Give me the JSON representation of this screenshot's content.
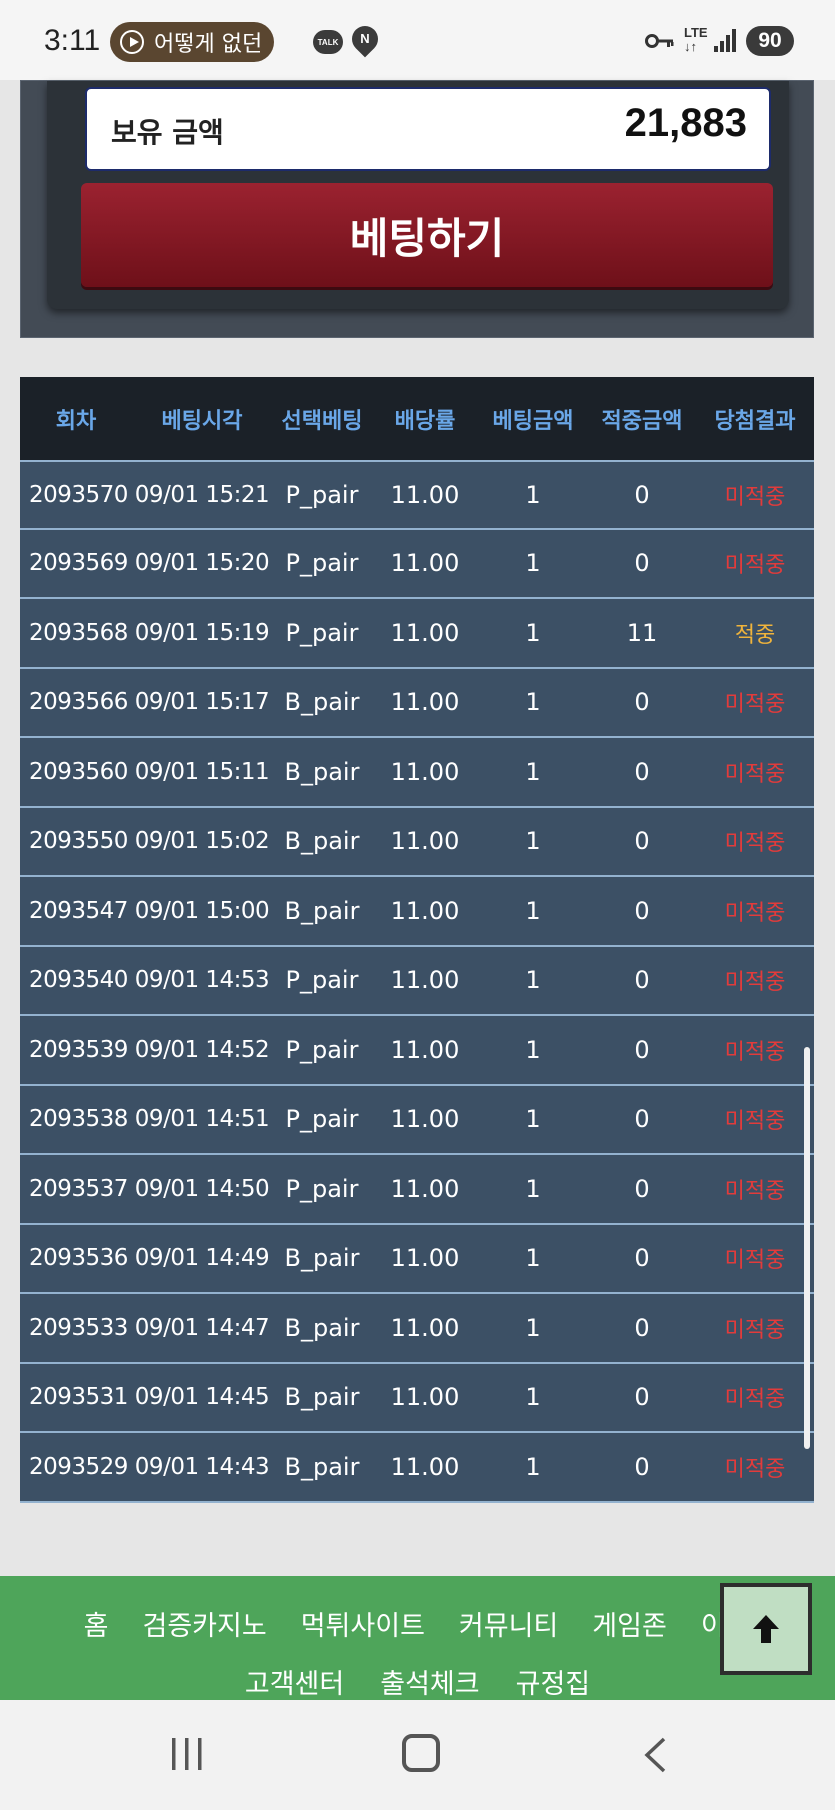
{
  "status_bar": {
    "time": "3:11",
    "media_title": "어떻게 없던",
    "talk_badge": "TALK",
    "pin_letter": "N",
    "network": "LTE",
    "battery": "90"
  },
  "betting_panel": {
    "balance_label": "보유 금액",
    "balance_value": "21,883",
    "bet_button_label": "베팅하기"
  },
  "table": {
    "headers": [
      "회차",
      "베팅시각",
      "선택베팅",
      "배당률",
      "베팅금액",
      "적중금액",
      "당첨결과"
    ],
    "rows": [
      {
        "round": "2093570",
        "time": "09/01 15:21",
        "pick": "P_pair",
        "odds": "11.00",
        "bet": "1",
        "win": "0",
        "result": "미적중"
      },
      {
        "round": "2093569",
        "time": "09/01 15:20",
        "pick": "P_pair",
        "odds": "11.00",
        "bet": "1",
        "win": "0",
        "result": "미적중"
      },
      {
        "round": "2093568",
        "time": "09/01 15:19",
        "pick": "P_pair",
        "odds": "11.00",
        "bet": "1",
        "win": "11",
        "result": "적중"
      },
      {
        "round": "2093566",
        "time": "09/01 15:17",
        "pick": "B_pair",
        "odds": "11.00",
        "bet": "1",
        "win": "0",
        "result": "미적중"
      },
      {
        "round": "2093560",
        "time": "09/01 15:11",
        "pick": "B_pair",
        "odds": "11.00",
        "bet": "1",
        "win": "0",
        "result": "미적중"
      },
      {
        "round": "2093550",
        "time": "09/01 15:02",
        "pick": "B_pair",
        "odds": "11.00",
        "bet": "1",
        "win": "0",
        "result": "미적중"
      },
      {
        "round": "2093547",
        "time": "09/01 15:00",
        "pick": "B_pair",
        "odds": "11.00",
        "bet": "1",
        "win": "0",
        "result": "미적중"
      },
      {
        "round": "2093540",
        "time": "09/01 14:53",
        "pick": "P_pair",
        "odds": "11.00",
        "bet": "1",
        "win": "0",
        "result": "미적중"
      },
      {
        "round": "2093539",
        "time": "09/01 14:52",
        "pick": "P_pair",
        "odds": "11.00",
        "bet": "1",
        "win": "0",
        "result": "미적중"
      },
      {
        "round": "2093538",
        "time": "09/01 14:51",
        "pick": "P_pair",
        "odds": "11.00",
        "bet": "1",
        "win": "0",
        "result": "미적중"
      },
      {
        "round": "2093537",
        "time": "09/01 14:50",
        "pick": "P_pair",
        "odds": "11.00",
        "bet": "1",
        "win": "0",
        "result": "미적중"
      },
      {
        "round": "2093536",
        "time": "09/01 14:49",
        "pick": "B_pair",
        "odds": "11.00",
        "bet": "1",
        "win": "0",
        "result": "미적중"
      },
      {
        "round": "2093533",
        "time": "09/01 14:47",
        "pick": "B_pair",
        "odds": "11.00",
        "bet": "1",
        "win": "0",
        "result": "미적중"
      },
      {
        "round": "2093531",
        "time": "09/01 14:45",
        "pick": "B_pair",
        "odds": "11.00",
        "bet": "1",
        "win": "0",
        "result": "미적중"
      },
      {
        "round": "2093529",
        "time": "09/01 14:43",
        "pick": "B_pair",
        "odds": "11.00",
        "bet": "1",
        "win": "0",
        "result": "미적중"
      }
    ]
  },
  "footer_nav": {
    "line1": [
      "홈",
      "검증카지노",
      "먹튀사이트",
      "커뮤니티",
      "게임존",
      "이벤트"
    ],
    "line2": [
      "고객센터",
      "출석체크",
      "규정집"
    ]
  },
  "colors": {
    "result_miss": "#e23b3b",
    "result_hit": "#f0b43c",
    "header_text": "#6aa7e8",
    "nav_green": "#4ea55a"
  },
  "icons": {
    "scroll_top": "arrow-up-icon",
    "android_recent": "recent-apps-icon",
    "android_home": "home-icon",
    "android_back": "back-icon"
  }
}
